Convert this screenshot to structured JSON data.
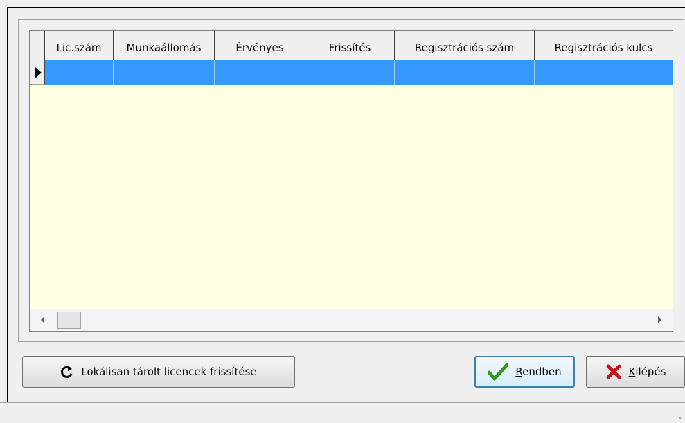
{
  "grid": {
    "columns": [
      {
        "label": "Lic.szám",
        "w": 0
      },
      {
        "label": "Munkaállomás"
      },
      {
        "label": "Érvényes"
      },
      {
        "label": "Frissítés"
      },
      {
        "label": "Regisztrációs szám"
      },
      {
        "label": "Regisztrációs kulcs"
      }
    ]
  },
  "buttons": {
    "refresh_label": "Lokálisan tárolt licencek frissítése",
    "ok_label": "Rendben",
    "ok_mnemonic": "R",
    "exit_label": "Kilépés",
    "exit_mnemonic": "K"
  },
  "colors": {
    "selected_row": "#3399ff",
    "grid_background": "#ffffe1",
    "ok_check": "#2e9a1e",
    "exit_x": "#c81414"
  }
}
